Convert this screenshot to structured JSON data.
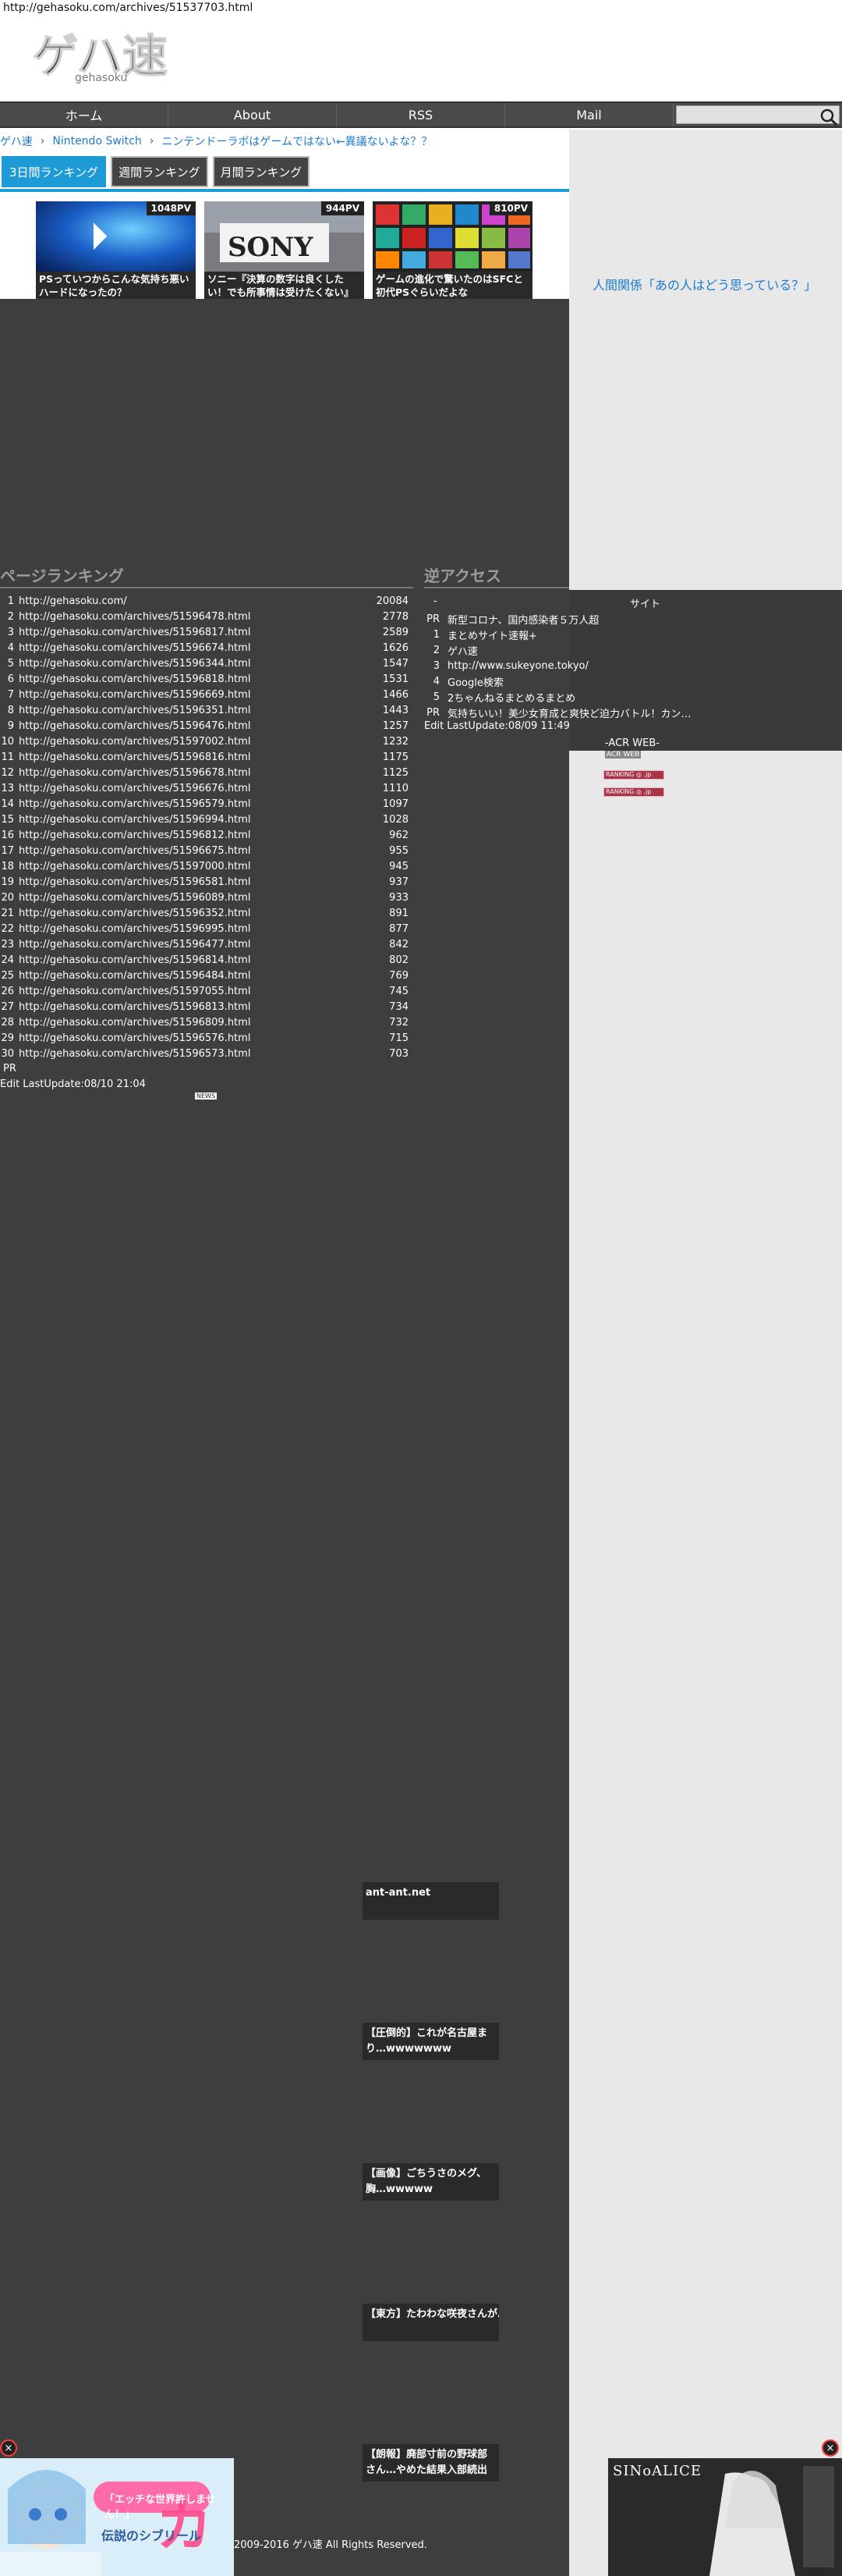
{
  "browser": {
    "url": "http://gehasoku.com/archives/51537703.html"
  },
  "site": {
    "logo_text": "ゲハ速"
  },
  "nav": {
    "items": [
      "ホーム",
      "About",
      "RSS",
      "Mail"
    ],
    "search_placeholder": ""
  },
  "breadcrumb": {
    "items": [
      "ゲハ速",
      "Nintendo Switch",
      "ニンテンドーラボはゲームではない←異議ないよな？？"
    ],
    "separator": "›"
  },
  "ranking_tabs": [
    "3日間ランキング",
    "週間ランキング",
    "月間ランキング"
  ],
  "featured": [
    {
      "pv": "1048PV",
      "caption": "PSっていつからこんな気持ち悪いハードになったの？"
    },
    {
      "pv": "944PV",
      "caption": "ソニー『決算の数字は良くしたい！でも所事情は受けたくない』"
    },
    {
      "pv": "810PV",
      "caption": "ゲームの進化で驚いたのはSFCと初代PSぐらいだよな"
    }
  ],
  "sidebar": {
    "link": "人間関係「あの人はどう思っている？」"
  },
  "page_ranking": {
    "title": "ページランキング",
    "rows": [
      {
        "no": "1",
        "url": "http://gehasoku.com/",
        "count": "20084"
      },
      {
        "no": "2",
        "url": "http://gehasoku.com/archives/51596478.html",
        "count": "2778"
      },
      {
        "no": "3",
        "url": "http://gehasoku.com/archives/51596817.html",
        "count": "2589"
      },
      {
        "no": "4",
        "url": "http://gehasoku.com/archives/51596674.html",
        "count": "1626"
      },
      {
        "no": "5",
        "url": "http://gehasoku.com/archives/51596344.html",
        "count": "1547"
      },
      {
        "no": "6",
        "url": "http://gehasoku.com/archives/51596818.html",
        "count": "1531"
      },
      {
        "no": "7",
        "url": "http://gehasoku.com/archives/51596669.html",
        "count": "1466"
      },
      {
        "no": "8",
        "url": "http://gehasoku.com/archives/51596351.html",
        "count": "1443"
      },
      {
        "no": "9",
        "url": "http://gehasoku.com/archives/51596476.html",
        "count": "1257"
      },
      {
        "no": "10",
        "url": "http://gehasoku.com/archives/51597002.html",
        "count": "1232"
      },
      {
        "no": "11",
        "url": "http://gehasoku.com/archives/51596816.html",
        "count": "1175"
      },
      {
        "no": "12",
        "url": "http://gehasoku.com/archives/51596678.html",
        "count": "1125"
      },
      {
        "no": "13",
        "url": "http://gehasoku.com/archives/51596676.html",
        "count": "1110"
      },
      {
        "no": "14",
        "url": "http://gehasoku.com/archives/51596579.html",
        "count": "1097"
      },
      {
        "no": "15",
        "url": "http://gehasoku.com/archives/51596994.html",
        "count": "1028"
      },
      {
        "no": "16",
        "url": "http://gehasoku.com/archives/51596812.html",
        "count": "962"
      },
      {
        "no": "17",
        "url": "http://gehasoku.com/archives/51596675.html",
        "count": "955"
      },
      {
        "no": "18",
        "url": "http://gehasoku.com/archives/51597000.html",
        "count": "945"
      },
      {
        "no": "19",
        "url": "http://gehasoku.com/archives/51596581.html",
        "count": "937"
      },
      {
        "no": "20",
        "url": "http://gehasoku.com/archives/51596089.html",
        "count": "933"
      },
      {
        "no": "21",
        "url": "http://gehasoku.com/archives/51596352.html",
        "count": "891"
      },
      {
        "no": "22",
        "url": "http://gehasoku.com/archives/51596995.html",
        "count": "877"
      },
      {
        "no": "23",
        "url": "http://gehasoku.com/archives/51596477.html",
        "count": "842"
      },
      {
        "no": "24",
        "url": "http://gehasoku.com/archives/51596814.html",
        "count": "802"
      },
      {
        "no": "25",
        "url": "http://gehasoku.com/archives/51596484.html",
        "count": "769"
      },
      {
        "no": "26",
        "url": "http://gehasoku.com/archives/51597055.html",
        "count": "745"
      },
      {
        "no": "27",
        "url": "http://gehasoku.com/archives/51596813.html",
        "count": "734"
      },
      {
        "no": "28",
        "url": "http://gehasoku.com/archives/51596809.html",
        "count": "732"
      },
      {
        "no": "29",
        "url": "http://gehasoku.com/archives/51596576.html",
        "count": "715"
      },
      {
        "no": "30",
        "url": "http://gehasoku.com/archives/51596573.html",
        "count": "703"
      }
    ],
    "pr": "PR",
    "last_update": "Edit LastUpdate:08/10 21:04",
    "badge": "NEWS"
  },
  "reverse_access": {
    "title": "逆アクセス",
    "header_site": "サイト",
    "header_dash": "-",
    "rows": [
      {
        "no": "PR",
        "name": "新型コロナ、国内感染者５万人超"
      },
      {
        "no": "1",
        "name": "まとめサイト速報+"
      },
      {
        "no": "2",
        "name": "ゲハ速"
      },
      {
        "no": "3",
        "name": "http://www.sukeyone.tokyo/"
      },
      {
        "no": "4",
        "name": "Google検索"
      },
      {
        "no": "5",
        "name": "2ちゃんねるまとめるまとめ"
      },
      {
        "no": "PR",
        "name": "気持ちいい！美少女育成と爽快ど迫力バトル！カン…"
      }
    ],
    "last_update": "Edit LastUpdate:08/09 11:49",
    "acr_label": "-ACR WEB-",
    "acr_sub": "ACR WEB",
    "badges": [
      "RANKING ◎ .jp",
      "RANKING ◎ .jp"
    ]
  },
  "ad_cards": [
    "ant-ant.net",
    "【圧倒的】これが名古屋まり…wwwwwww",
    "【画像】ごちうさのメグ、胸…wwwww",
    "【東方】たわわな咲夜さんが…",
    "【朗報】廃部寸前の野球部さん…やめた結果入部続出www"
  ],
  "corner_ads": {
    "left_lines": [
      "「エッチな世界許しません！」",
      "伝説のシブリール"
    ],
    "right_title": "SINoALICE"
  },
  "footer": "2009-2016 ゲハ速 All Rights Reserved."
}
